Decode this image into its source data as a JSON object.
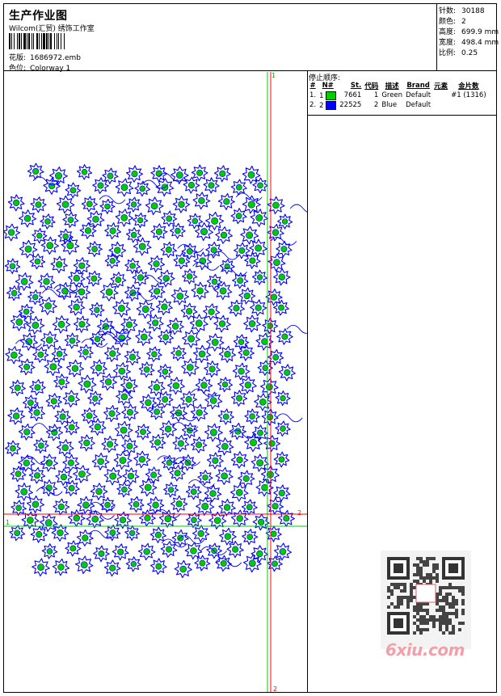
{
  "header": {
    "title": "生产作业图",
    "company": "Wilcom(汇贸) 绣饰工作室",
    "design_label": "花版:",
    "design_value": "1686972.emb",
    "colorway_label": "色位:",
    "colorway_value": "Colorway 1"
  },
  "stats": [
    {
      "label": "针数:",
      "value": "30188"
    },
    {
      "label": "颜色:",
      "value": "2"
    },
    {
      "label": "高度:",
      "value": "699.9 mm"
    },
    {
      "label": "宽度:",
      "value": "498.4 mm"
    },
    {
      "label": "比例:",
      "value": "0.25"
    }
  ],
  "legend": {
    "title": "停止顺序:",
    "headers": [
      "#",
      "N#",
      "St.",
      "代码",
      "描述",
      "Brand",
      "元素",
      "金片数"
    ],
    "rows": [
      {
        "num": "1.",
        "n": "1",
        "color": "#00cc00",
        "st": "7661",
        "code": "1",
        "desc": "Green",
        "brand": "Default",
        "sequin": "#1 (1316)"
      },
      {
        "num": "2.",
        "n": "2",
        "color": "#0000ff",
        "st": "22525",
        "code": "2",
        "desc": "Blue",
        "brand": "Default",
        "sequin": ""
      }
    ]
  },
  "markers": {
    "v_top": "1",
    "v_bottom": "2",
    "h_left": "1",
    "h_right": "2"
  },
  "watermark": {
    "text": "6xiu.com"
  },
  "colors": {
    "green": "#00cc00",
    "blue": "#0000ff",
    "red": "#ff0000"
  }
}
